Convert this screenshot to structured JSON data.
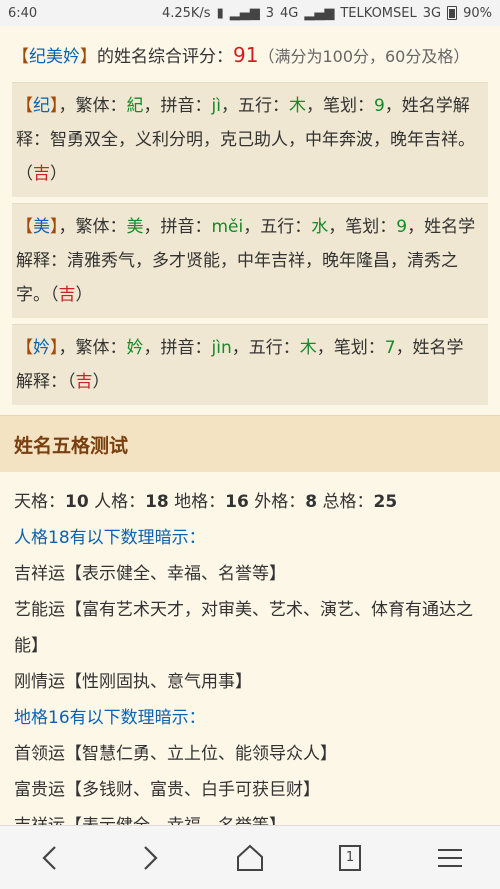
{
  "status_bar": {
    "time": "6:40",
    "speed": "4.25K/s",
    "signal1": "3",
    "network1": "4G",
    "carrier": "TELKOMSEL",
    "network2": "3G",
    "battery": "90%"
  },
  "summary": {
    "open": "【",
    "name": "纪美妗",
    "close": "】",
    "text": "的姓名综合评分：",
    "score": "91",
    "hint": "（满分为100分，60分及格）"
  },
  "chars": [
    {
      "char": "纪",
      "label_trad": "，繁体：",
      "trad": "紀",
      "label_pinyin": "，拼音：",
      "pinyin": "jì",
      "label_wuxing": "，五行：",
      "wuxing": "木",
      "label_bihua": "，笔划：",
      "bihua": "9",
      "label_explain": "，姓名学解释：",
      "explain": "智勇双全，义利分明，克己助人，中年奔波，晚年吉祥。",
      "luck": "吉"
    },
    {
      "char": "美",
      "label_trad": "，繁体：",
      "trad": "美",
      "label_pinyin": "，拼音：",
      "pinyin": "měi",
      "label_wuxing": "，五行：",
      "wuxing": "水",
      "label_bihua": "，笔划：",
      "bihua": "9",
      "label_explain": "，姓名学解释：",
      "explain": "清雅秀气，多才贤能，中年吉祥，晚年隆昌，清秀之字。",
      "luck": "吉"
    },
    {
      "char": "妗",
      "label_trad": "，繁体：",
      "trad": "妗",
      "label_pinyin": "，拼音：",
      "pinyin": "jìn",
      "label_wuxing": "，五行：",
      "wuxing": "木",
      "label_bihua": "，笔划：",
      "bihua": "7",
      "label_explain": "，姓名学解释：",
      "explain": "",
      "luck": "吉"
    }
  ],
  "section": {
    "title": "姓名五格测试"
  },
  "wuge": {
    "tian_label": "天格：",
    "tian": "10",
    "ren_label": "人格：",
    "ren": "18",
    "di_label": "地格：",
    "di": "16",
    "wai_label": "外格：",
    "wai": "8",
    "zong_label": "总格：",
    "zong": "25",
    "ren_header": "人格18有以下数理暗示：",
    "ren_items": [
      "吉祥运【表示健全、幸福、名誉等】",
      "艺能运【富有艺术天才，对审美、艺术、演艺、体育有通达之能】",
      "刚情运【性刚固执、意气用事】"
    ],
    "di_header": "地格16有以下数理暗示：",
    "di_items": [
      "首领运【智慧仁勇、立上位、能领导众人】",
      "富贵运【多钱财、富贵、白手可获巨财】",
      "吉祥运【表示健全、幸福、名誉等】"
    ]
  },
  "nav": {
    "tabs_count": "1"
  }
}
